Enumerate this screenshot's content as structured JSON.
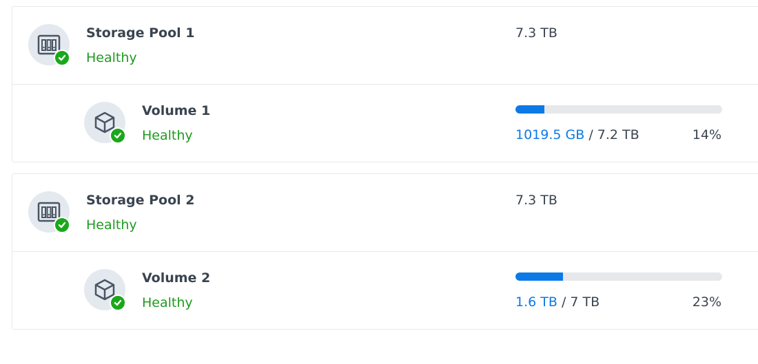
{
  "pools": [
    {
      "name": "Storage Pool 1",
      "status": "Healthy",
      "size": "7.3 TB",
      "volume": {
        "name": "Volume 1",
        "status": "Healthy",
        "used": "1019.5 GB",
        "separator": " / ",
        "total": "7.2 TB",
        "percent_label": "14%",
        "usage_fraction": 0.14
      }
    },
    {
      "name": "Storage Pool 2",
      "status": "Healthy",
      "size": "7.3 TB",
      "volume": {
        "name": "Volume 2",
        "status": "Healthy",
        "used": "1.6 TB",
        "separator": " / ",
        "total": "7 TB",
        "percent_label": "23%",
        "usage_fraction": 0.23
      }
    }
  ],
  "icons": {
    "pool": "storage-pool-icon",
    "volume": "volume-cube-icon",
    "status": "check-circle-icon"
  },
  "colors": {
    "healthy": "#1f9a1f",
    "badge": "#1aa81a",
    "accent": "#0c7ae6",
    "bar_track": "#e6e8ea"
  }
}
